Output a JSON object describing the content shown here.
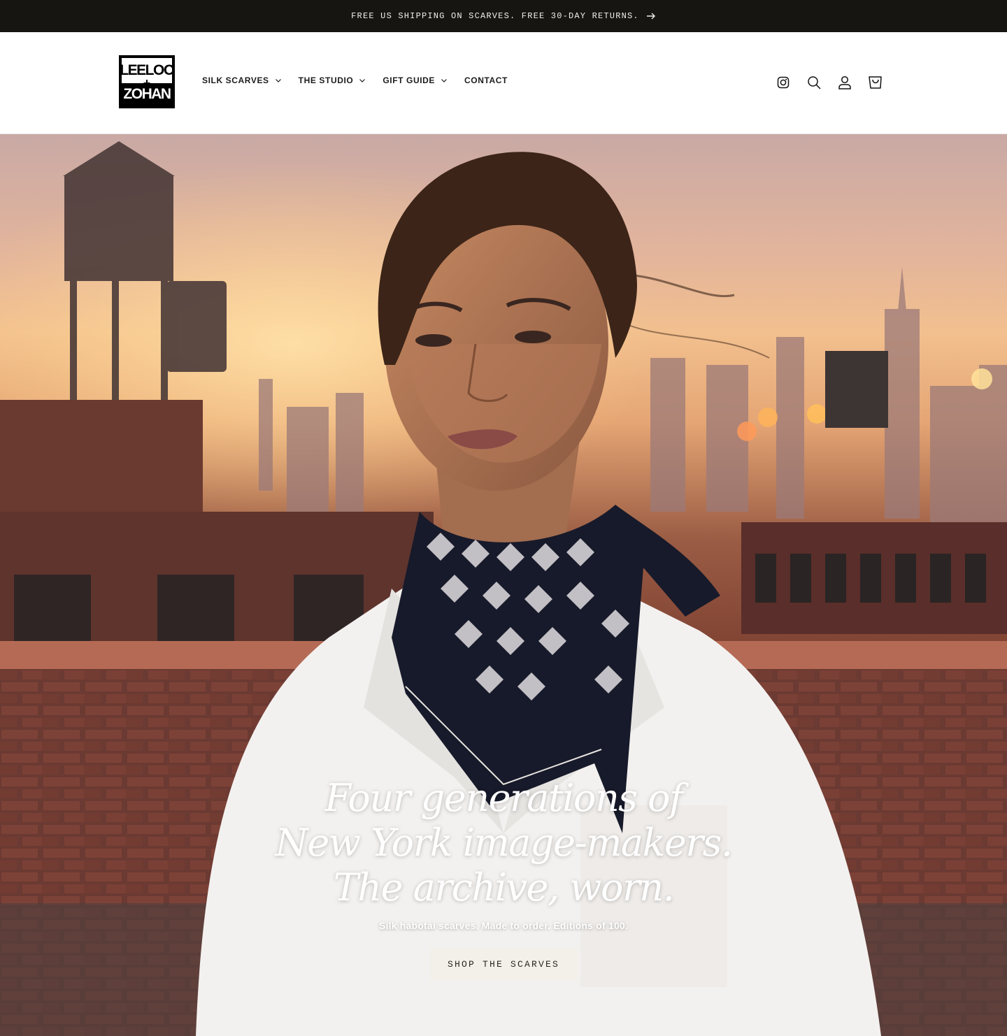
{
  "announcement": {
    "text": "FREE US SHIPPING ON SCARVES. FREE 30-DAY RETURNS.",
    "icon": "arrow-right-icon"
  },
  "header": {
    "logo": {
      "line1": "LEELOO",
      "plus": "+",
      "line2": "ZOHAN"
    },
    "nav": [
      {
        "label": "SILK SCARVES",
        "has_dropdown": true
      },
      {
        "label": "THE STUDIO",
        "has_dropdown": true
      },
      {
        "label": "GIFT GUIDE",
        "has_dropdown": true
      },
      {
        "label": "CONTACT",
        "has_dropdown": false
      }
    ],
    "icons": [
      "instagram-icon",
      "search-icon",
      "account-icon",
      "cart-icon"
    ]
  },
  "hero": {
    "headline_line1": "Four generations of",
    "headline_line2": "New York image-makers.",
    "headline_line3": "The archive, worn.",
    "subline": "Silk habotai scarves. Made to order. Editions of 100.",
    "cta_label": "SHOP THE SCARVES"
  },
  "colors": {
    "announcement_bg": "#161512",
    "cta_bg": "#f3efe9"
  }
}
